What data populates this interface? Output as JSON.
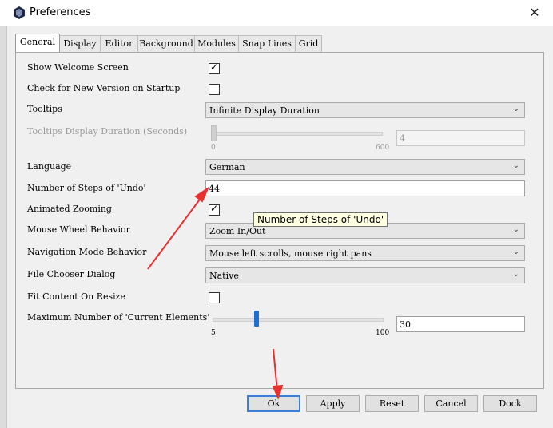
{
  "window": {
    "title": "Preferences"
  },
  "tabs": [
    "General",
    "Display",
    "Editor",
    "Background",
    "Modules",
    "Snap Lines",
    "Grid"
  ],
  "settings": {
    "show_welcome": {
      "label": "Show Welcome Screen",
      "checked": true
    },
    "check_version": {
      "label": "Check for New Version on Startup",
      "checked": false
    },
    "tooltips": {
      "label": "Tooltips",
      "value": "Infinite Display Duration"
    },
    "tooltips_duration": {
      "label": "Tooltips Display Duration (Seconds)",
      "slider_min": "0",
      "slider_max": "600",
      "value": "4"
    },
    "language": {
      "label": "Language",
      "value": "German"
    },
    "undo_steps": {
      "label": "Number of Steps of 'Undo'",
      "value": "44"
    },
    "animated_zooming": {
      "label": "Animated Zooming",
      "checked": true
    },
    "mouse_wheel": {
      "label": "Mouse Wheel Behavior",
      "value": "Zoom In/Out"
    },
    "navigation_mode": {
      "label": "Navigation Mode Behavior",
      "value": "Mouse left scrolls, mouse right pans"
    },
    "file_chooser": {
      "label": "File Chooser Dialog",
      "value": "Native"
    },
    "fit_content": {
      "label": "Fit Content On Resize",
      "checked": false
    },
    "max_current": {
      "label": "Maximum Number of 'Current Elements'",
      "slider_min": "5",
      "slider_max": "100",
      "value": "30"
    }
  },
  "tooltip_popup": "Number of Steps of 'Undo'",
  "buttons": {
    "ok": "Ok",
    "apply": "Apply",
    "reset": "Reset",
    "cancel": "Cancel",
    "dock": "Dock"
  },
  "icons": {
    "check": "✓",
    "dropdown": "chevron-down-icon",
    "close": "close-icon"
  },
  "colors": {
    "annotation_arrow": "#e8312f",
    "default_button_border": "#3c7fd6",
    "tooltip_bg": "#ffffe1"
  }
}
